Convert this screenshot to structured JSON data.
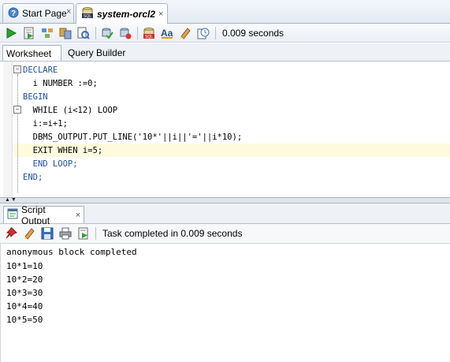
{
  "doc_tabs": [
    {
      "label": "Start Page",
      "close": "×"
    },
    {
      "label": "system-orcl2",
      "close": "×"
    }
  ],
  "toolbar": {
    "status_text": "0.009 seconds"
  },
  "worksheet_tabs": [
    {
      "label": "Worksheet"
    },
    {
      "label": "Query Builder"
    }
  ],
  "editor": {
    "lines": [
      "DECLARE",
      "  i NUMBER :=0;",
      "BEGIN",
      "  WHILE (i<12) LOOP",
      "  i:=i+1;",
      "  DBMS_OUTPUT.PUT_LINE('10*'||i||'='||i*10);",
      "  EXIT WHEN i=5;",
      "  END LOOP;",
      "END;"
    ]
  },
  "output_panel": {
    "tab_label": "Script Output",
    "tab_close": "×",
    "status_text": "Task completed in 0.009 seconds",
    "lines": [
      "anonymous block completed",
      "10*1=10",
      "10*2=20",
      "10*3=30",
      "10*4=40",
      "10*5=50"
    ]
  },
  "colors": {
    "keyword": "#1f4f9c",
    "literal": "#1a8f1a",
    "highlight": "#fdfbdc"
  }
}
